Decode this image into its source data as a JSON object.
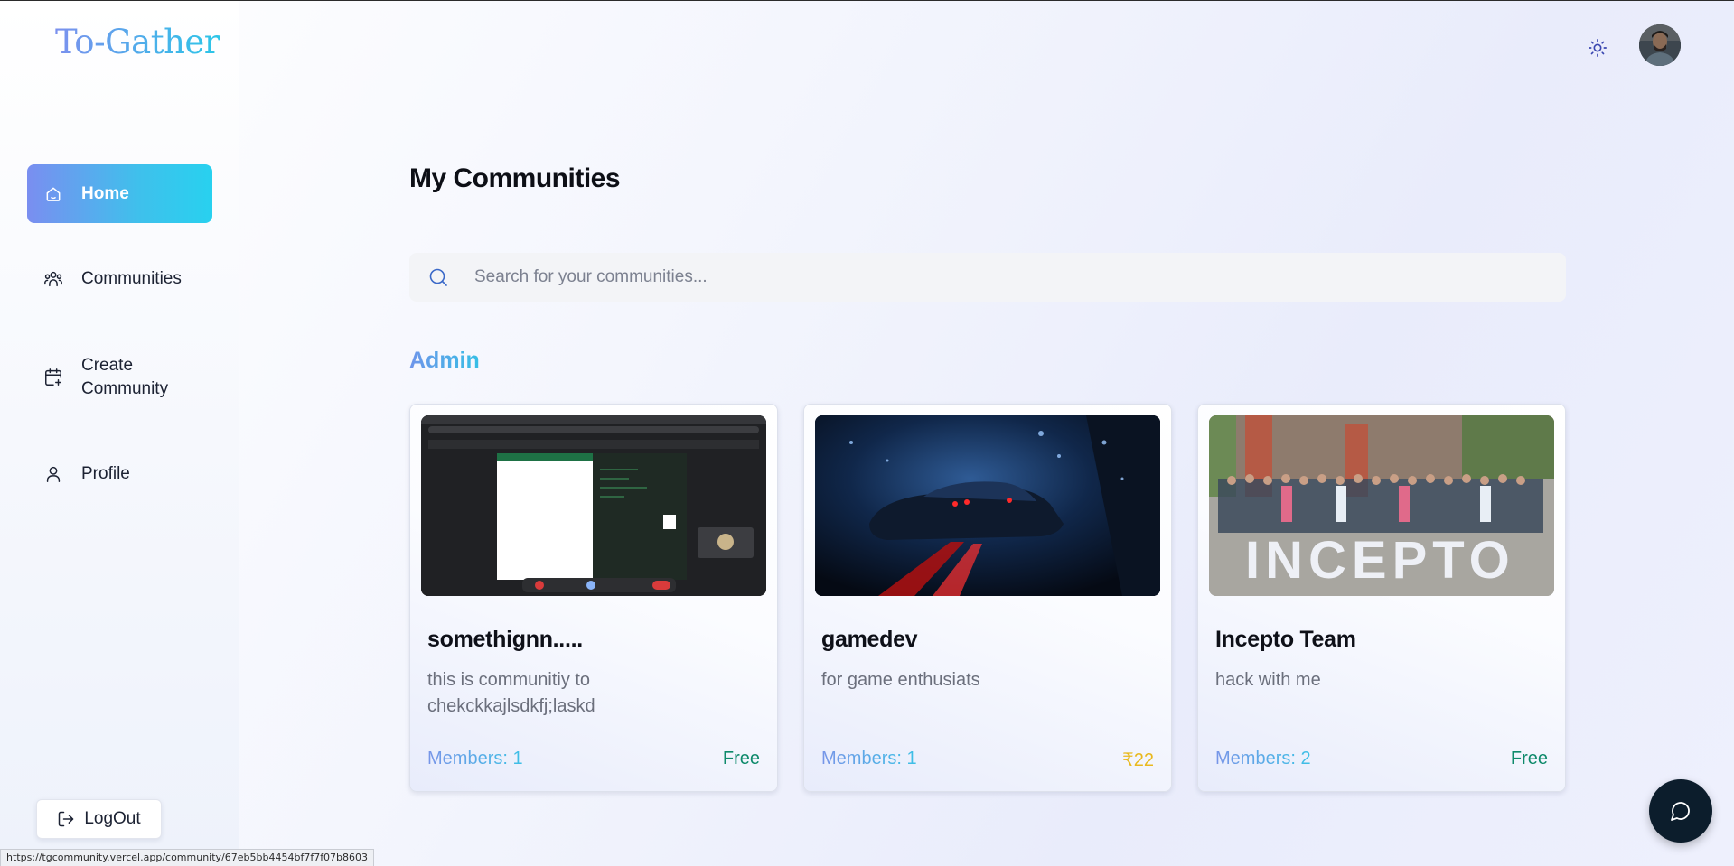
{
  "app": {
    "logo": "To-Gather"
  },
  "sidebar": {
    "items": [
      {
        "label": "Home",
        "icon": "home-icon",
        "active": true
      },
      {
        "label": "Communities",
        "icon": "users-icon",
        "active": false
      },
      {
        "label": "Create Community",
        "icon": "calendar-plus-icon",
        "active": false
      },
      {
        "label": "Profile",
        "icon": "user-icon",
        "active": false
      }
    ],
    "logout_label": "LogOut"
  },
  "header": {
    "theme_toggle_icon": "sun-icon",
    "avatar_icon": "user-avatar"
  },
  "main": {
    "title": "My Communities",
    "search": {
      "placeholder": "Search for your communities...",
      "value": ""
    },
    "section_label": "Admin",
    "cards": [
      {
        "title": "somethignn.....",
        "description": "this is communitiy to chekckkajlsdkfj;laskd",
        "members": "Members: 1",
        "price": "Free",
        "image": "screen-recording-screenshot"
      },
      {
        "title": "gamedev",
        "description": "for game enthusiats",
        "members": "Members: 1",
        "price": "₹22",
        "image": "night-car-photo"
      },
      {
        "title": "Incepto Team",
        "description": "hack with me",
        "members": "Members: 2",
        "price": "Free",
        "image": "team-group-photo"
      }
    ]
  },
  "status_bar": {
    "url": "https://tgcommunity.vercel.app/community/67eb5bb4454bf7f7f07b8603"
  },
  "colors": {
    "accent_start": "#7a8ef0",
    "accent_end": "#28d1ef",
    "free_price": "#0f8a6b",
    "paid_price": "#e9b91f",
    "chat_fab": "#0c1d2c"
  }
}
